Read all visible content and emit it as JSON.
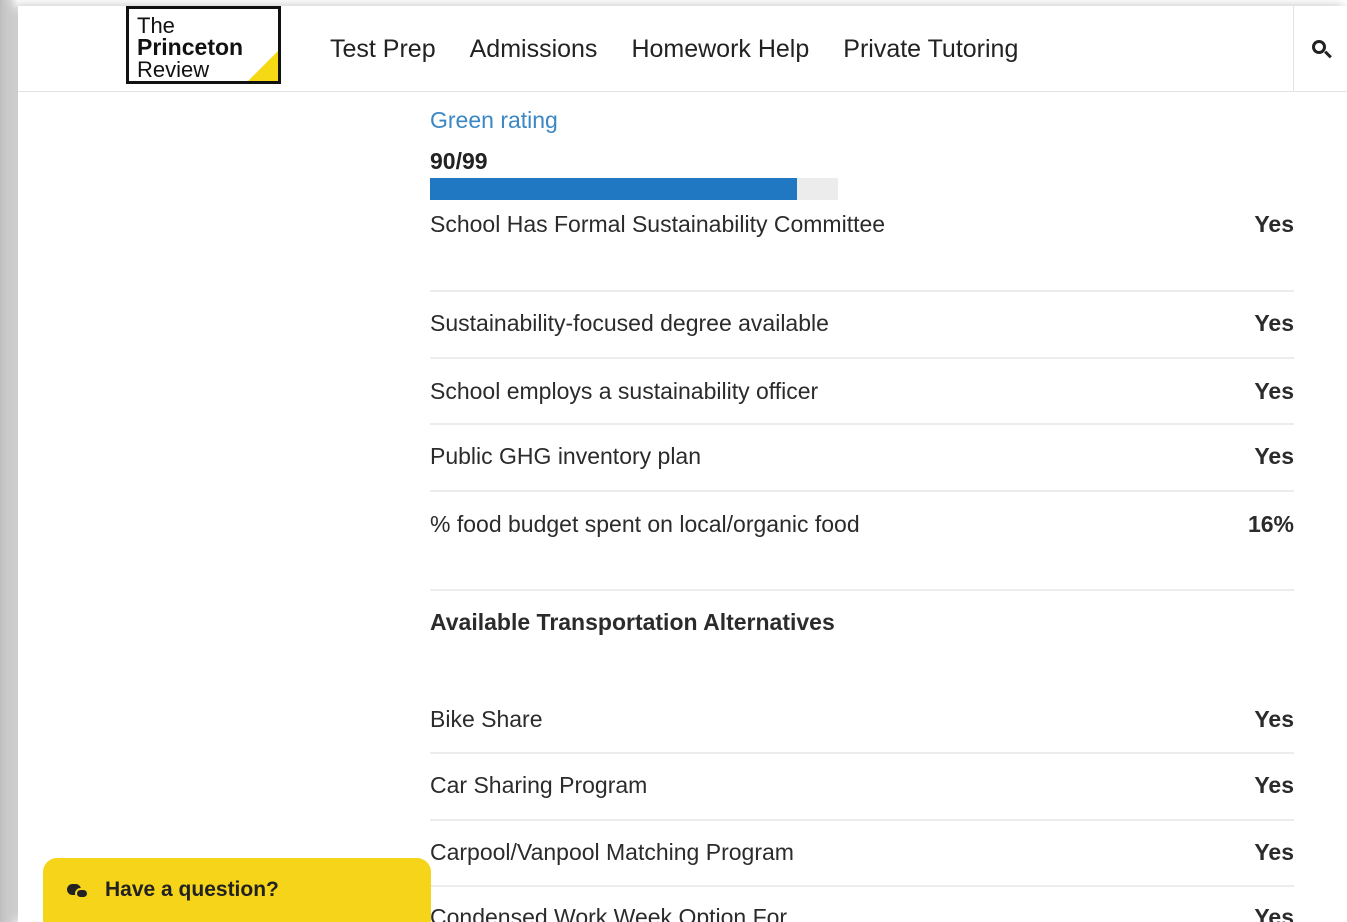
{
  "logo": {
    "line1": "The",
    "line2": "Princeton",
    "line3": "Review"
  },
  "nav": [
    {
      "label": "Test Prep"
    },
    {
      "label": "Admissions"
    },
    {
      "label": "Homework Help"
    },
    {
      "label": "Private Tutoring"
    }
  ],
  "green_rating": {
    "label": "Green rating",
    "value_text": "90/99",
    "value": 90,
    "max": 99,
    "bar_color": "#1f78c1"
  },
  "rows": [
    {
      "label": "School Has Formal Sustainability Committee",
      "value": "Yes"
    },
    {
      "label": "Sustainability-focused degree available",
      "value": "Yes"
    },
    {
      "label": "School employs a sustainability officer",
      "value": "Yes"
    },
    {
      "label": "Public GHG inventory plan",
      "value": "Yes"
    },
    {
      "label": "% food budget spent on local/organic food",
      "value": "16%"
    },
    {
      "label": "Available Transportation Alternatives",
      "value": "",
      "heading": true
    },
    {
      "label": "Bike Share",
      "value": "Yes"
    },
    {
      "label": "Car Sharing Program",
      "value": "Yes"
    },
    {
      "label": "Carpool/Vanpool Matching Program",
      "value": "Yes"
    },
    {
      "label": "Condensed Work Week Option For",
      "value": "Yes"
    }
  ],
  "chat": {
    "label": "Have a question?",
    "color": "#f5d419"
  },
  "accent_color": "#3b87c4"
}
